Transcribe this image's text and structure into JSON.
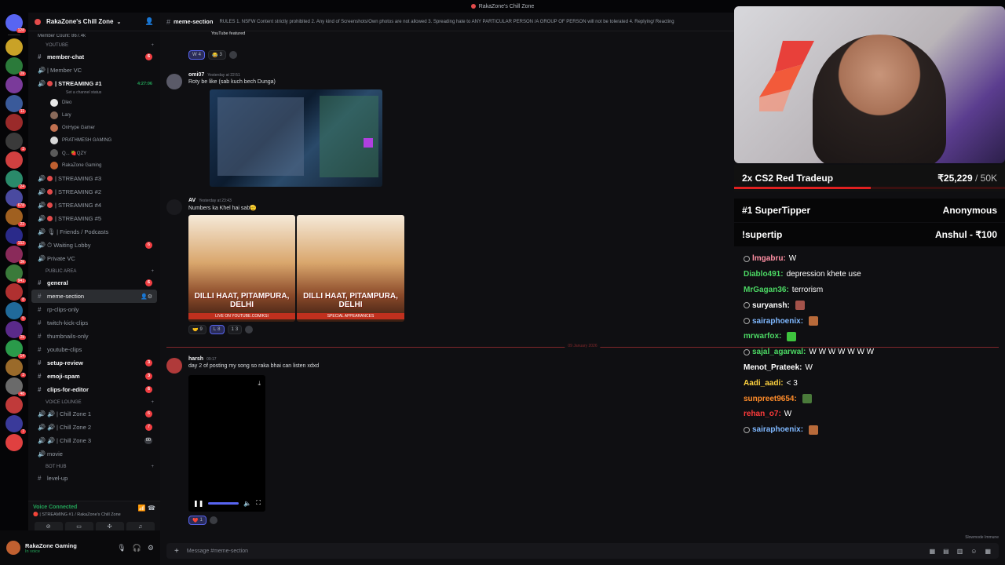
{
  "titlebar": {
    "title": "RakaZone's Chill Zone"
  },
  "server": {
    "name": "RakaZone's Chill Zone"
  },
  "sidebar": {
    "cut_top": "Member Count: 867.4k",
    "categories": {
      "youtube": "YOUTUBE",
      "public": "PUBLIC AREA",
      "voice": "Voice Lounge",
      "bot": "Bot Hub"
    },
    "member_chat": "member-chat",
    "member_vc": "| Member VC",
    "streaming1": "| STREAMING #1",
    "streaming1_time": "4:27:06",
    "streaming1_status": "Set a channel status",
    "voice_members": [
      "Dleo",
      "Lary",
      "OnHype Gamer",
      "PRATHMESH GAMING",
      "Q... 🍓QZY",
      "RakaZone Gaming"
    ],
    "streaming2": "| STREAMING #3",
    "streaming3": "| STREAMING #2",
    "streaming4": "| STREAMING #4",
    "streaming5": "| STREAMING #5",
    "friends": "| Friends / Podcasts",
    "waiting": "Waiting Lobby",
    "private_vc": "Private VC",
    "general": "general",
    "meme": "meme-section",
    "rp": "rp-clips-only",
    "twitch": "twitch-kick-clips",
    "thumbs": "thumbnails-only",
    "yt": "youtube-clips",
    "setup": "setup-review",
    "emoji": "emoji-spam",
    "clips": "clips-for-editor",
    "chill1": "| Chill Zone 1",
    "chill2": "| Chill Zone 2",
    "chill3": "| Chill Zone 3",
    "movie": "movie",
    "level_up": "level-up",
    "badges": {
      "member_chat": "6",
      "waiting": "6",
      "general": "6",
      "setup": "3",
      "emoji": "3",
      "clips": "6",
      "chill1": "6",
      "chill2": "7",
      "chill3": "00"
    }
  },
  "voice": {
    "title": "Voice Connected",
    "sub": "🔴 | STREAMING #1 / RakaZone's Chill Zone"
  },
  "user": {
    "name": "RakaZone Gaming",
    "status": "In voice"
  },
  "channel": {
    "name": "meme-section",
    "topic": "RULES 1. NSFW Content strictly prohibited 2. Any kind of Screenshots/Own photos are not allowed 3. Spreading hate to ANY PARTICULAR PERSON /A GROUP OF PERSON will not be tolerated 4. Replying/ Reacting"
  },
  "messages": {
    "m0": {
      "caption": "YouTube featured",
      "reactions": [
        {
          "e": "W",
          "n": "4"
        },
        {
          "e": "😂",
          "n": "3"
        }
      ]
    },
    "m1": {
      "author": "omi07",
      "ts": "Yesterday at 22:51",
      "text": "Roty be like (sab kuch bech Dunga)"
    },
    "m2": {
      "author": "AV",
      "ts": "Yesterday at 23:43",
      "text": "Numbers ka Khel hai sab🫡",
      "poster1_sub": "LIVE ON YOUTUBE.COM/KSI",
      "poster2_sub": "SPECIAL APPEARANCES",
      "poster_title": "DILLI HAAT, PITAMPURA, DELHI",
      "reactions": [
        {
          "e": "🤝",
          "n": "9"
        },
        {
          "e": "L",
          "n": "8"
        },
        {
          "e": "1",
          "n": "3"
        }
      ]
    },
    "date": "09 January 2026",
    "m3": {
      "author": "harsh",
      "ts": "09:17",
      "text": "day 2 of posting my song so raka bhai can listen xdxd",
      "reactions": [
        {
          "e": "❤️",
          "n": "1"
        }
      ]
    }
  },
  "composer": {
    "placeholder": "Message #meme-section"
  },
  "slowmode": "Slowmode Immune",
  "overlay": {
    "goal_label": "2x CS2 Red Tradeup",
    "goal_amount": "₹25,229",
    "goal_target": " / 50K",
    "goal_progress": 0.505,
    "supertipper_label": "#1 SuperTipper",
    "supertipper_name": "Anonymous",
    "cmd_label": "!supertip",
    "cmd_value": "Anshul - ₹100",
    "chat": [
      {
        "user": "lmgabru:",
        "msg": "W",
        "color": "#ff8fa3",
        "mod": true
      },
      {
        "user": "Diablo491:",
        "msg": "depression khete use",
        "color": "#4cd964",
        "mod": false
      },
      {
        "user": "MrGagan36:",
        "msg": "terrorism",
        "color": "#4cd964",
        "mod": false
      },
      {
        "user": "suryansh:",
        "msg": "",
        "color": "#ffffff",
        "mod": true,
        "emote": "#a3524a"
      },
      {
        "user": "sairaphoenix:",
        "msg": "",
        "color": "#7fb8ff",
        "mod": true,
        "emote": "#b86a3a"
      },
      {
        "user": "mrwarfox:",
        "msg": "",
        "color": "#4cd964",
        "mod": false,
        "emote": "#3ec43e"
      },
      {
        "user": "sajal_agarwal:",
        "msg": "W W W W W W W",
        "color": "#4cd964",
        "mod": true
      },
      {
        "user": "Menot_Prateek:",
        "msg": "W",
        "color": "#ffffff",
        "mod": false
      },
      {
        "user": "Aadi_aadi:",
        "msg": "< 3",
        "color": "#ffd23f",
        "mod": false
      },
      {
        "user": "sunpreet9654:",
        "msg": "",
        "color": "#ff8c2a",
        "mod": false,
        "emote": "#4a7a3a"
      },
      {
        "user": "rehan_o7:",
        "msg": "W",
        "color": "#ff3b3b",
        "mod": false
      },
      {
        "user": "sairaphoenix:",
        "msg": "",
        "color": "#7fb8ff",
        "mod": true,
        "emote": "#b86a3a"
      }
    ]
  }
}
